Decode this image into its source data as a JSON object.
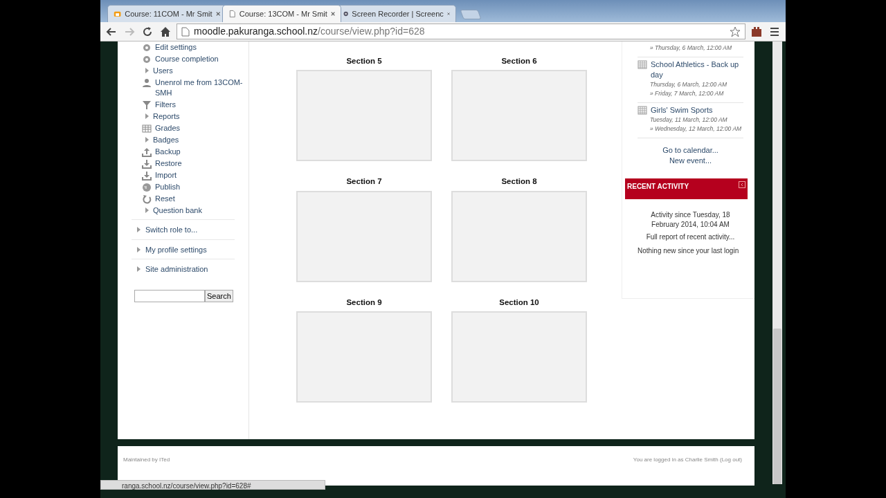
{
  "browser": {
    "tabs": [
      {
        "title": "Course: 11COM - Mr Smit",
        "selected": false
      },
      {
        "title": "Course: 13COM - Mr Smit",
        "selected": true
      },
      {
        "title": "Screen Recorder | Screenc",
        "selected": false
      }
    ],
    "address": {
      "host": "moodle.pakuranga.school.nz",
      "path": "/course/view.php?id=628"
    }
  },
  "admin_menu": {
    "items": [
      {
        "label": "Edit settings",
        "kind": "gear"
      },
      {
        "label": "Course completion",
        "kind": "gear"
      },
      {
        "label": "Users",
        "kind": "caret"
      },
      {
        "label": "Unenrol me from 13COM-SMH",
        "kind": "person"
      },
      {
        "label": "Filters",
        "kind": "filter"
      },
      {
        "label": "Reports",
        "kind": "caret"
      },
      {
        "label": "Grades",
        "kind": "grid"
      },
      {
        "label": "Badges",
        "kind": "caret"
      },
      {
        "label": "Backup",
        "kind": "upload"
      },
      {
        "label": "Restore",
        "kind": "download"
      },
      {
        "label": "Import",
        "kind": "download"
      },
      {
        "label": "Publish",
        "kind": "globe"
      },
      {
        "label": "Reset",
        "kind": "reset"
      },
      {
        "label": "Question bank",
        "kind": "caret"
      }
    ],
    "groups": [
      "Switch role to...",
      "My profile settings",
      "Site administration"
    ],
    "search": {
      "button": "Search"
    }
  },
  "sections": [
    {
      "title": "Section 5"
    },
    {
      "title": "Section 6"
    },
    {
      "title": "Section 7"
    },
    {
      "title": "Section 8"
    },
    {
      "title": "Section 9"
    },
    {
      "title": "Section 10"
    }
  ],
  "calendar": {
    "events": [
      {
        "dates": [
          "» Thursday, 6 March, 12:00 AM"
        ]
      },
      {
        "title": "School Athletics - Back up day",
        "dates": [
          "Thursday, 6 March, 12:00 AM",
          "» Friday, 7 March, 12:00 AM"
        ]
      },
      {
        "title": "Girls' Swim Sports",
        "dates": [
          "Tuesday, 11 March, 12:00 AM",
          "» Wednesday, 12 March, 12:00 AM"
        ]
      }
    ],
    "links": [
      "Go to calendar...",
      "New event..."
    ]
  },
  "recent_activity": {
    "title": "RECENT ACTIVITY",
    "since": "Activity since Tuesday, 18 February 2014, 10:04 AM",
    "full_report": "Full report of recent activity...",
    "message": "Nothing new since your last login"
  },
  "footer": {
    "left": "Maintained by ITed",
    "right": "You are logged in as Charlie Smith",
    "link": "(Log out)"
  },
  "status_url": "ranga.school.nz/course/view.php?id=628#"
}
